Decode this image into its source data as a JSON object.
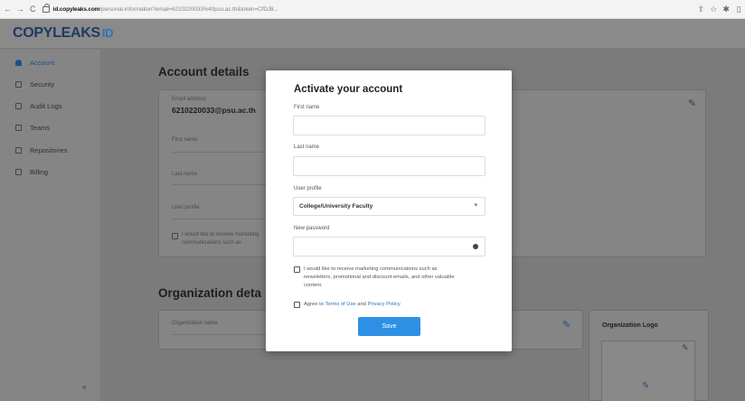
{
  "browser": {
    "nav_back": "←",
    "nav_forward": "→",
    "nav_reload": "C",
    "url_host": "id.copyleaks.com",
    "url_path": "/personal-information?email=6210220033%40psu.ac.th&token=CfDJ8...",
    "icons": [
      "share-icon",
      "star-icon",
      "extensions-icon",
      "window-icon"
    ]
  },
  "app": {
    "logo_text": "COPYLEAKS",
    "logo_suffix": "ID"
  },
  "sidebar": {
    "items": [
      {
        "label": "Account",
        "icon": "person-icon",
        "active": true
      },
      {
        "label": "Security",
        "icon": "lock-icon",
        "active": false
      },
      {
        "label": "Audit Logs",
        "icon": "list-icon",
        "active": false
      },
      {
        "label": "Teams",
        "icon": "team-icon",
        "active": false
      },
      {
        "label": "Repositories",
        "icon": "gear-icon",
        "active": false
      },
      {
        "label": "Billing",
        "icon": "billing-icon",
        "active": false
      }
    ],
    "collapse": "«"
  },
  "account": {
    "title": "Account details",
    "email_label": "Email address",
    "email_value": "6210220033@psu.ac.th",
    "first_name_label": "First name",
    "last_name_label": "Last name",
    "user_profile_label": "User profile",
    "marketing_text": "I would like to receive marketing communications such as newsletters, promotional and discount emails"
  },
  "organization": {
    "title": "Organization deta",
    "name_label": "Organization name",
    "logo_title": "Organization Logo"
  },
  "modal": {
    "title": "Activate your account",
    "first_name_label": "First name",
    "last_name_label": "Last name",
    "user_profile_label": "User profile",
    "user_profile_value": "College/University Faculty",
    "password_label": "New password",
    "marketing_text": "I would like to receive marketing communications such as newsletters, promotional and discount emails, and other valuable content.",
    "agree_prefix": "Agree to",
    "terms_link": "Terms of Use",
    "and": "and",
    "privacy_link": "Privacy Policy.",
    "save_label": "Save"
  }
}
